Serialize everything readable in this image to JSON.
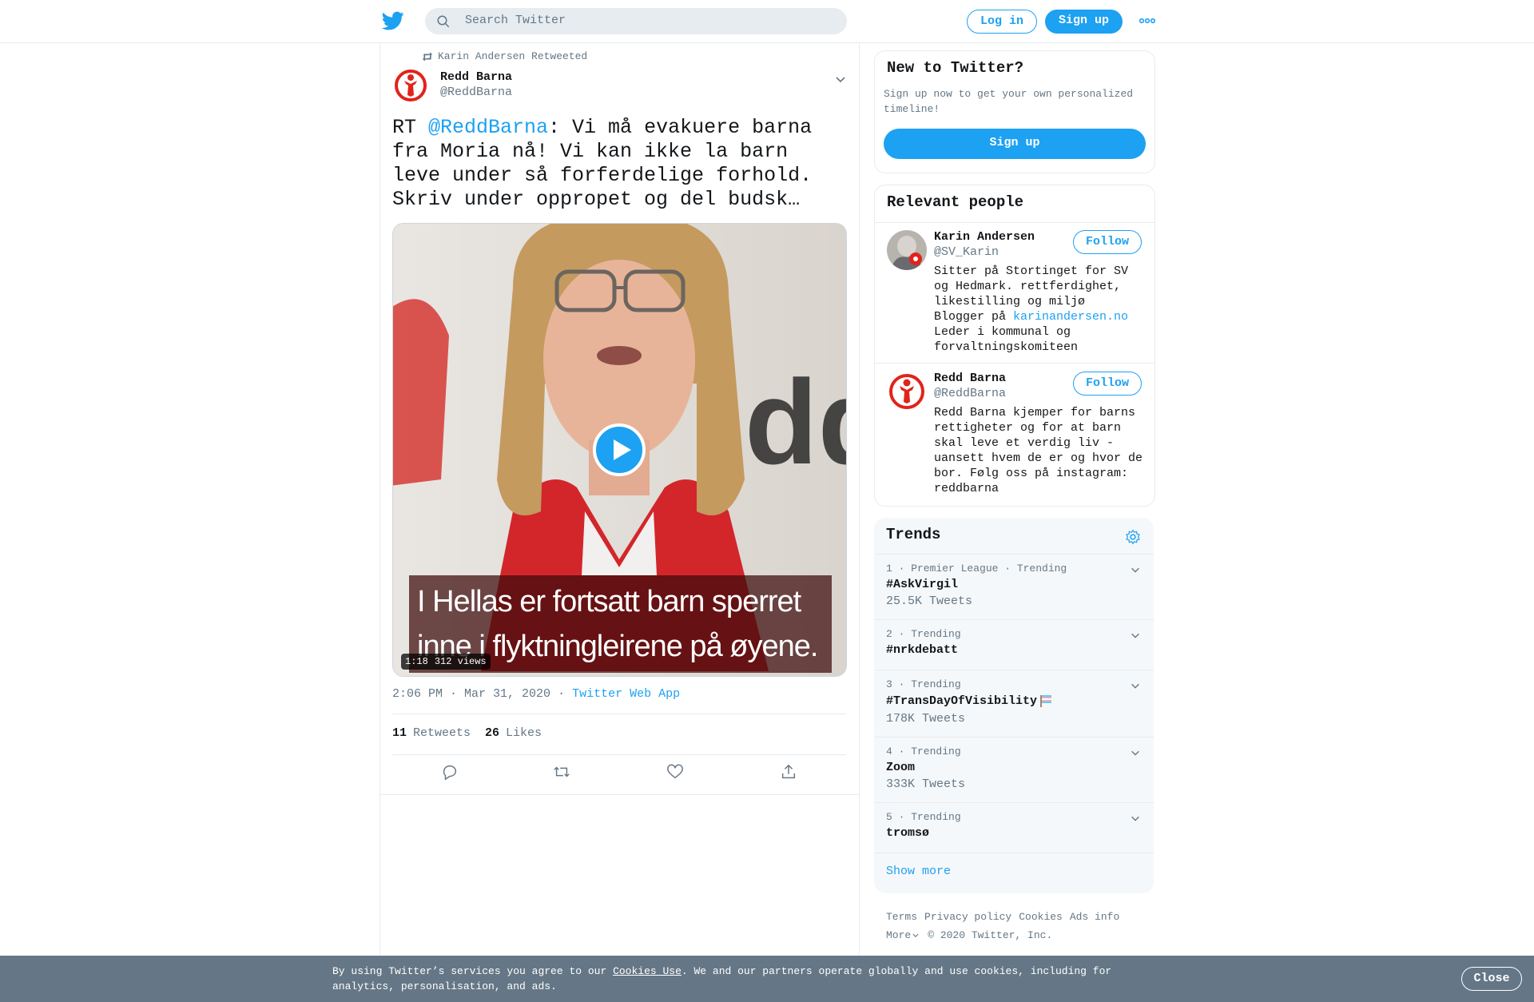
{
  "header": {
    "search_placeholder": "Search Twitter",
    "login_label": "Log in",
    "signup_label": "Sign up",
    "logo_icon": "twitter-bird-icon",
    "more_icon": "more-dots-icon"
  },
  "tweet": {
    "retweeted_by": "Karin Andersen Retweeted",
    "author_name": "Redd Barna",
    "author_handle": "@ReddBarna",
    "text_prefix": "RT ",
    "text_mention": "@ReddBarna",
    "text_body": ": Vi må evakuere barna fra Moria nå! Vi kan ikke la barn leve under så forferdelige forhold. Skriv under oppropet og del budsk…",
    "video": {
      "caption_line1": "I Hellas er fortsatt barn sperret",
      "caption_line2": "inne i flyktningleirene på øyene.",
      "duration": "1:18",
      "views": "312 views"
    },
    "time": "2:06 PM · Mar 31, 2020",
    "separator": "·",
    "source_app": "Twitter Web App",
    "retweets_count": "11",
    "retweets_label": "Retweets",
    "likes_count": "26",
    "likes_label": "Likes"
  },
  "sidebar": {
    "new_to_twitter": {
      "title": "New to Twitter?",
      "description": "Sign up now to get your own personalized timeline!",
      "signup_label": "Sign up"
    },
    "relevant_people": {
      "title": "Relevant people",
      "people": [
        {
          "name": "Karin Andersen",
          "handle": "@SV_Karin",
          "follow_label": "Follow",
          "bio_lines": [
            "Sitter på Stortinget for SV og Hedmark. rettferdighet, likestilling og miljø"
          ],
          "bio_prefix": "Blogger på ",
          "bio_link": "karinandersen.no",
          "bio_suffix": "Leder i kommunal og forvaltningskomiteen"
        },
        {
          "name": "Redd Barna",
          "handle": "@ReddBarna",
          "follow_label": "Follow",
          "bio": "Redd Barna kjemper for barns rettigheter og for at barn skal leve et verdig liv - uansett hvem de er og hvor de bor. Følg oss på instagram: reddbarna"
        }
      ]
    },
    "trends": {
      "title": "Trends",
      "items": [
        {
          "meta": "1 · Premier League · Trending",
          "name": "#AskVirgil",
          "count": "25.5K Tweets"
        },
        {
          "meta": "2 · Trending",
          "name": "#nrkdebatt",
          "count": ""
        },
        {
          "meta": "3 · Trending",
          "name": "#TransDayOfVisibility",
          "count": "178K Tweets"
        },
        {
          "meta": "4 · Trending",
          "name": "Zoom",
          "count": "333K Tweets"
        },
        {
          "meta": "5 · Trending",
          "name": "tromsø",
          "count": ""
        }
      ],
      "show_more": "Show more"
    },
    "footer": {
      "links": [
        "Terms",
        "Privacy policy",
        "Cookies",
        "Ads info"
      ],
      "more": "More",
      "copyright": "© 2020 Twitter, Inc."
    }
  },
  "cookie_banner": {
    "text_prefix": "By using Twitter’s services you agree to our ",
    "link": "Cookies Use",
    "text_suffix": ". We and our partners operate globally and use cookies, including for analytics, personalisation, and ads.",
    "close_label": "Close"
  },
  "colors": {
    "accent": "#1da1f2",
    "muted": "#657786",
    "border": "#e6ecf0",
    "redd_barna_red": "#e2231a"
  }
}
